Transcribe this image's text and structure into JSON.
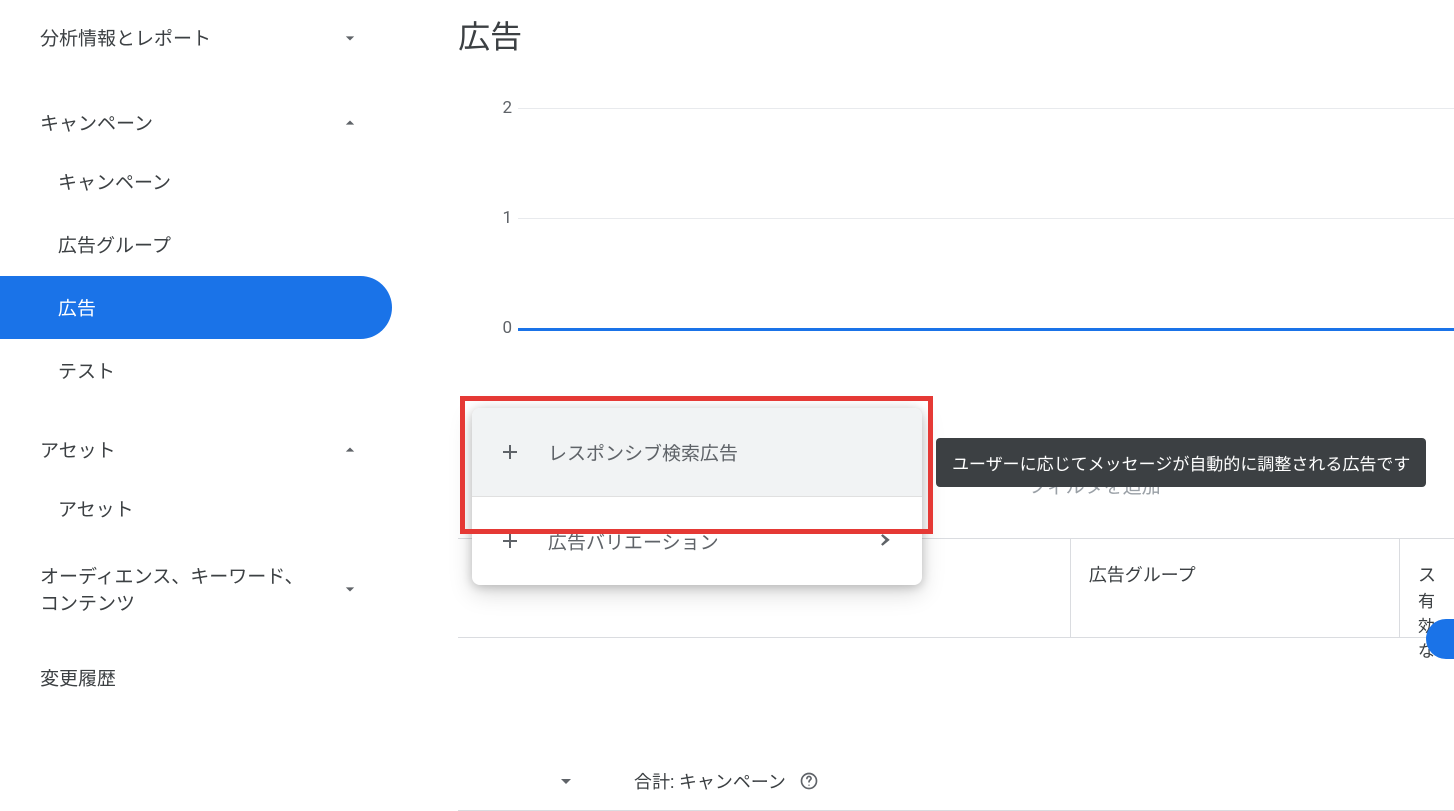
{
  "sidebar": {
    "section_analytics": "分析情報とレポート",
    "section_campaigns": "キャンペーン",
    "section_assets": "アセット",
    "section_audience": "オーディエンス、キーワード、コンテンツ",
    "section_history": "変更履歴",
    "sub_campaigns": "キャンペーン",
    "sub_adgroups": "広告グループ",
    "sub_ads": "広告",
    "sub_tests": "テスト",
    "sub_assets": "アセット"
  },
  "page": {
    "title": "広告"
  },
  "chart_data": {
    "type": "line",
    "y_ticks": [
      "2",
      "1",
      "0"
    ],
    "ylim": [
      0,
      2
    ],
    "series": [
      {
        "name": "",
        "values": [
          0,
          0,
          0,
          0,
          0
        ]
      }
    ]
  },
  "popup": {
    "item1": "レスポンシブ検索広告",
    "item2": "広告バリエーション"
  },
  "tooltip": {
    "text": "ユーザーに応じてメッセージが自動的に調整される広告です"
  },
  "filter": {
    "placeholder": "フィルタを追加"
  },
  "table": {
    "col_adgroup": "広告グループ",
    "col_status_prefix": "ス",
    "status_value": "有効な",
    "total_label": "合計: キャンペーン"
  }
}
